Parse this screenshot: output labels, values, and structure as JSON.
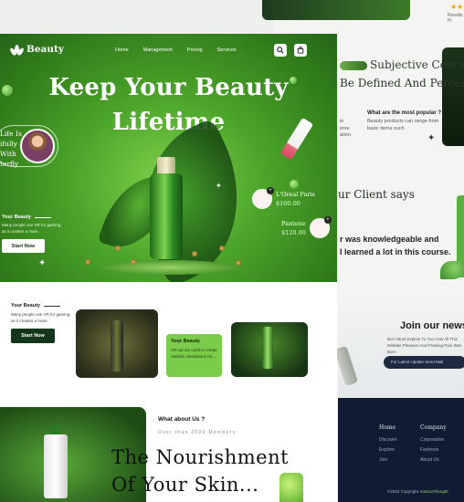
{
  "brand": {
    "name": "Beauty"
  },
  "nav": {
    "links": [
      "Home",
      "Management",
      "Pricing",
      "Services"
    ]
  },
  "hero": {
    "title_line1": "Keep Your Beauty",
    "title_line2": "Lifetime",
    "testimonial_lines": [
      "Life Is",
      "ifully",
      "With",
      "terfly"
    ],
    "side_heading": "Your Beauty",
    "side_text": "Many people use VR for gaming, as it creates a more.",
    "side_button": "Start Now",
    "products": [
      {
        "name": "L'Oreal Paris",
        "price": "$100.00"
      },
      {
        "name": "Pantene",
        "price": "$120.00"
      }
    ]
  },
  "row2": {
    "heading": "Your Beauty",
    "text": "Many people use VR for gaming, as it creates a more.",
    "button": "Start Now",
    "card_heading": "Your Beauty",
    "card_text": "VR can be used to create realistic simulations for..."
  },
  "about": {
    "heading": "What about Us ?",
    "members": "Over than 2000 Members",
    "title_line1": "The Nourishment",
    "title_line2": "Of Your Skin..."
  },
  "background_page": {
    "results": "Results Pr",
    "heading_line1": "Subjective Conce",
    "heading_line2": "Be Defined And Perceiv",
    "faq_question": "What are the most popular ?",
    "faq_answer": "Beauty products can range from basic items such",
    "partial_text": [
      "in",
      "erse",
      "ation."
    ],
    "client_heading": "ur Client says",
    "client_quote_line1": "r was knowledgeable and",
    "client_quote_line2": "I learned a lot in this course.",
    "news_heading": "Join our news",
    "news_text": "But I Must Explain To You How All This Mistake Pleasure And Praising Pain Was Born",
    "news_input_placeholder": "For Latest Update Send Mail",
    "footer_col1_title": "Home",
    "footer_col1_items": [
      "Discover",
      "Explore",
      "Join"
    ],
    "footer_col2_title": "Company",
    "footer_col2_items": [
      "Corporation",
      "Fashions",
      "About Us"
    ],
    "copyright": "©2023 Copyright.",
    "copyright_brand": "KalcanThought"
  }
}
